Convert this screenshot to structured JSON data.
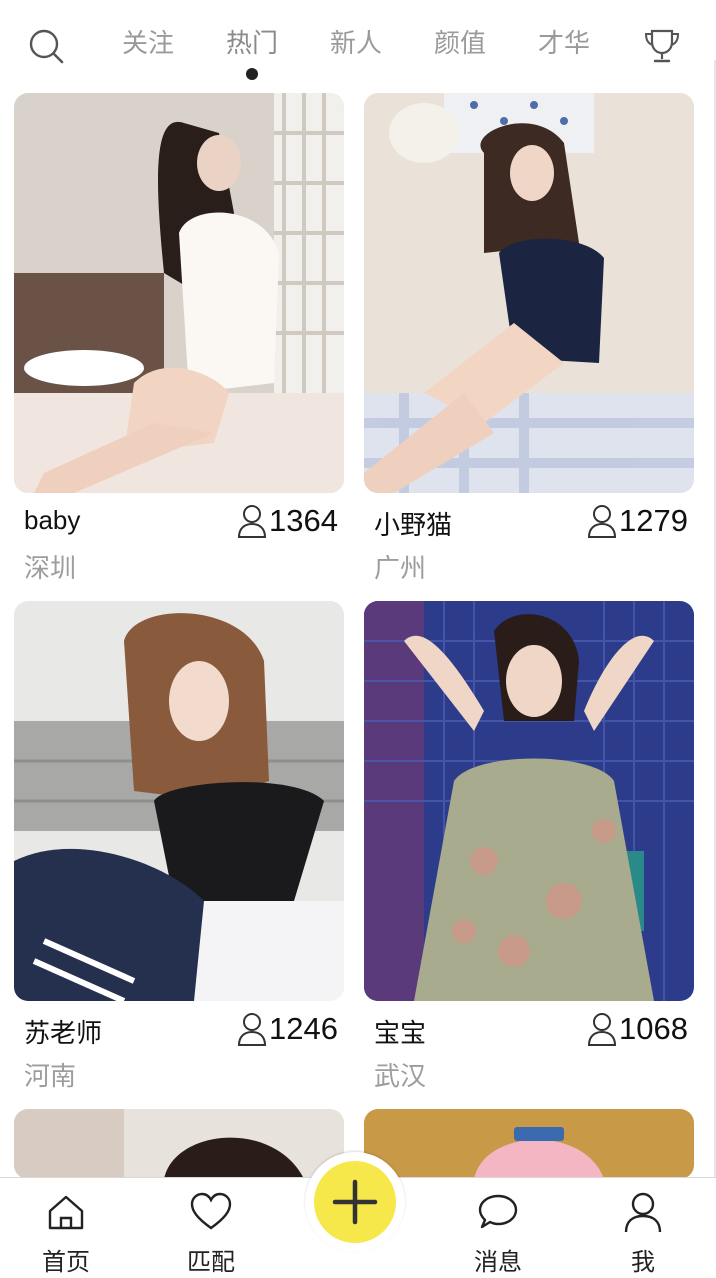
{
  "header": {
    "search_icon": "search-icon",
    "tabs": [
      {
        "label": "关注"
      },
      {
        "label": "热门",
        "active": true
      },
      {
        "label": "新人"
      },
      {
        "label": "颜值"
      },
      {
        "label": "才华"
      }
    ],
    "trophy_icon": "trophy-icon"
  },
  "cards": [
    {
      "name": "baby",
      "city": "深圳",
      "count": "1364"
    },
    {
      "name": "小野猫",
      "city": "广州",
      "count": "1279"
    },
    {
      "name": "苏老师",
      "city": "河南",
      "count": "1246"
    },
    {
      "name": "宝宝",
      "city": "武汉",
      "count": "1068"
    },
    {
      "name": "",
      "city": "",
      "count": ""
    },
    {
      "name": "",
      "city": "",
      "count": ""
    }
  ],
  "bottom_nav": {
    "items": [
      {
        "label": "首页",
        "icon": "home-icon"
      },
      {
        "label": "匹配",
        "icon": "heart-icon"
      },
      {
        "label": "消息",
        "icon": "message-icon"
      },
      {
        "label": "我",
        "icon": "user-icon"
      }
    ],
    "fab_icon": "plus-icon",
    "fab_color": "#f6e84a"
  }
}
